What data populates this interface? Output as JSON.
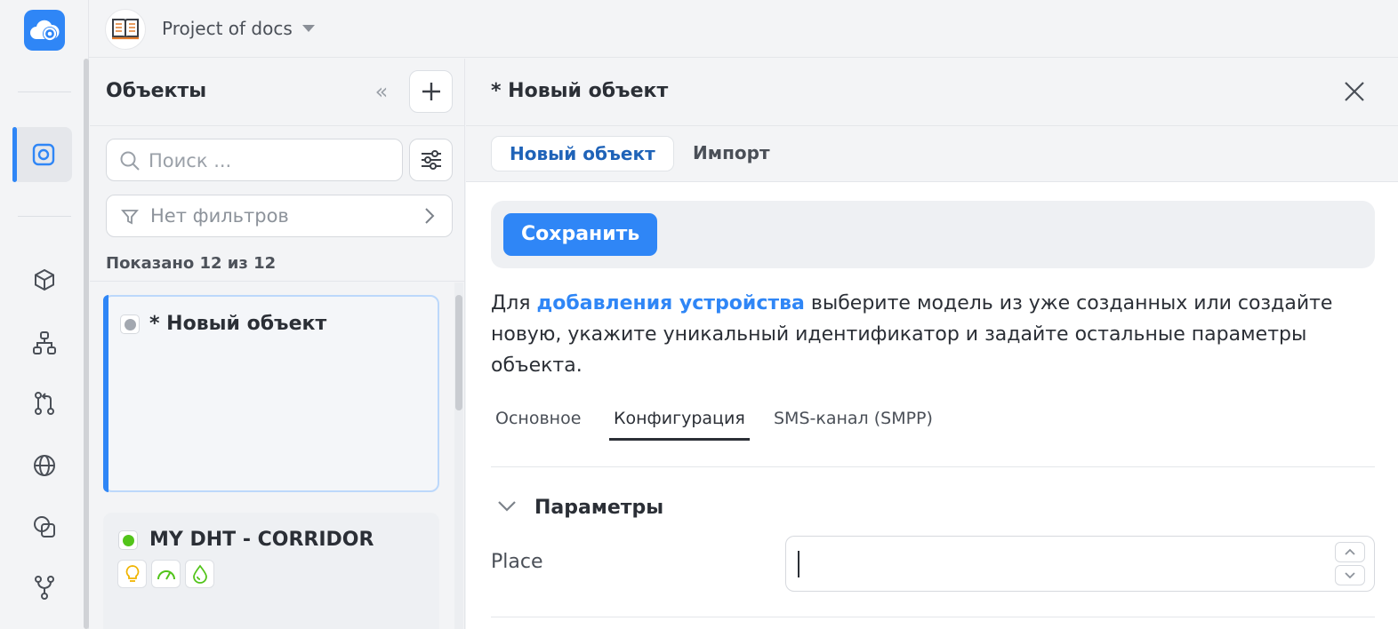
{
  "colors": {
    "accent": "#2f86f6",
    "status_new": "#a3a8b0",
    "status_online": "#52c41a"
  },
  "topbar": {
    "project_name": "Project of docs"
  },
  "rail": {
    "icons": [
      "objects-icon",
      "cube-icon",
      "hierarchy-icon",
      "pull-request-icon",
      "globe-icon",
      "overlap-icon",
      "branch-icon"
    ]
  },
  "objects": {
    "title": "Объекты",
    "collapse_glyph": "«",
    "search": {
      "placeholder": "Поиск ...",
      "value": ""
    },
    "filters_label": "Нет фильтров",
    "shown": "Показано 12 из 12",
    "cards": [
      {
        "title": "* Новый объект",
        "status": "new"
      },
      {
        "title": "MY DHT - CORRIDOR",
        "status": "online",
        "chips": [
          "bulb-icon",
          "gauge-icon",
          "drop-icon"
        ]
      }
    ]
  },
  "main": {
    "title": "* Новый объект",
    "tabs": [
      {
        "label": "Новый объект"
      },
      {
        "label": "Импорт"
      }
    ],
    "save_label": "Сохранить",
    "description": {
      "prefix": "Для ",
      "link": "добавления устройства",
      "suffix": " выберите модель из уже созданных или создайте новую, укажите уникальный идентификатор и задайте остальные параметры объекта."
    },
    "subtabs": [
      {
        "label": "Основное"
      },
      {
        "label": "Конфигурация"
      },
      {
        "label": "SMS-канал (SMPP)"
      }
    ],
    "section_title": "Параметры",
    "field": {
      "label": "Place",
      "value": ""
    }
  }
}
